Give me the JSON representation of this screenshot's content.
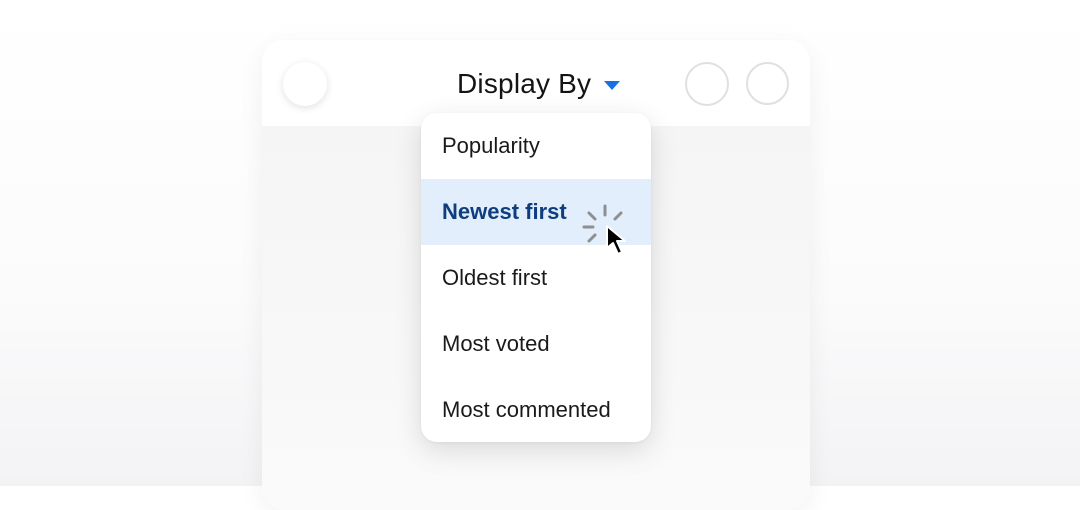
{
  "header": {
    "title": "Display By",
    "icons": [
      "menu-circle-icon",
      "circle-icon",
      "circle-icon"
    ]
  },
  "dropdown": {
    "options": [
      {
        "label": "Popularity",
        "selected": false
      },
      {
        "label": "Newest first",
        "selected": true
      },
      {
        "label": "Oldest first",
        "selected": false
      },
      {
        "label": "Most voted",
        "selected": false
      },
      {
        "label": "Most commented",
        "selected": false
      }
    ]
  },
  "colors": {
    "accent": "#1670e6",
    "selected_bg": "#e2eefc",
    "selected_text": "#0f3e7e"
  },
  "pointer": {
    "icon": "arrow-cursor-icon",
    "effect": "click-burst-icon"
  }
}
